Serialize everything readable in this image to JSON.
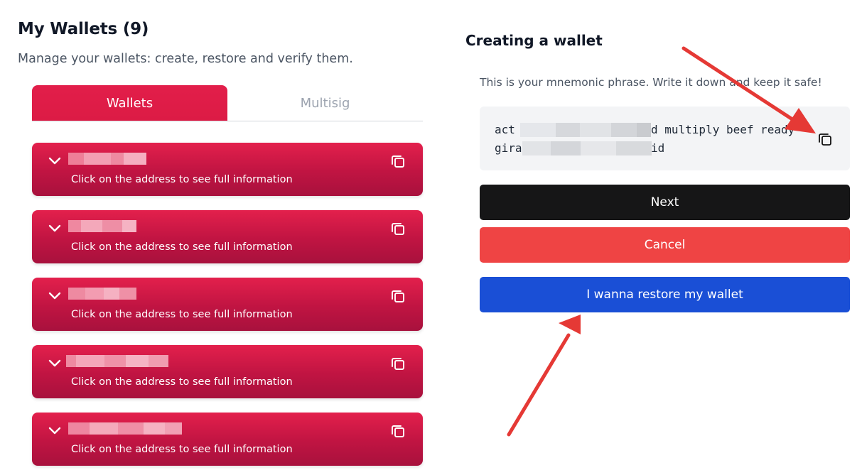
{
  "wallets_panel": {
    "title": "My Wallets (9)",
    "subtitle": "Manage your wallets: create, restore and verify them.",
    "tabs": [
      {
        "label": "Wallets",
        "active": true
      },
      {
        "label": "Multisig",
        "active": false
      }
    ],
    "wallet_cards": [
      {
        "info": "Click on the address to see full information",
        "address_redacted": true
      },
      {
        "info": "Click on the address to see full information",
        "address_redacted": true
      },
      {
        "info": "Click on the address to see full information",
        "address_redacted": true
      },
      {
        "info": "Click on the address to see full information",
        "address_redacted": true
      },
      {
        "info": "Click on the address to see full information",
        "address_redacted": true
      }
    ],
    "icons": {
      "expand": "chevron-down-icon",
      "copy": "copy-icon"
    }
  },
  "create_panel": {
    "title": "Creating a wallet",
    "hint": "This is your mnemonic phrase. Write it down and keep it safe!",
    "phrase_line1_start": "act",
    "phrase_line1_end": "d multiply beef ready",
    "phrase_line2_start": "gira",
    "phrase_line2_end": "id",
    "next_label": "Next",
    "cancel_label": "Cancel",
    "restore_label": "I wanna restore my wallet"
  },
  "colors": {
    "brand_red": "#e11d48",
    "next_button": "#161617",
    "cancel_button": "#ef4444",
    "restore_button": "#1a4fd6",
    "annotation_arrow": "#e53935"
  }
}
